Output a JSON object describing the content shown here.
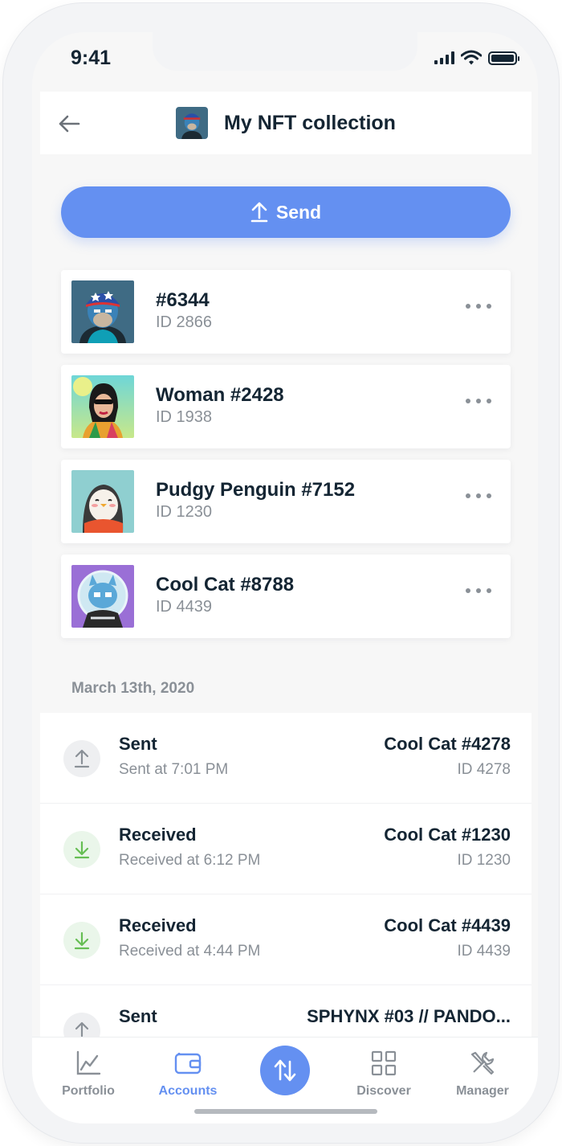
{
  "status_bar": {
    "time": "9:41"
  },
  "header": {
    "title": "My NFT collection",
    "back_icon": "arrow-left-icon"
  },
  "send_button": {
    "label": "Send",
    "icon": "upload-arrow-icon"
  },
  "nfts": [
    {
      "name": "#6344",
      "id": "ID 2866"
    },
    {
      "name": "Woman #2428",
      "id": "ID 1938"
    },
    {
      "name": "Pudgy Penguin #7152",
      "id": "ID 1230"
    },
    {
      "name": "Cool Cat #8788",
      "id": "ID 4439"
    }
  ],
  "history": {
    "date": "March 13th, 2020",
    "transactions": [
      {
        "type": "Sent",
        "time": "Sent at 7:01 PM",
        "nft": "Cool Cat #4278",
        "nft_id": "ID 4278",
        "direction": "sent"
      },
      {
        "type": "Received",
        "time": "Received at 6:12 PM",
        "nft": "Cool Cat #1230",
        "nft_id": "ID 1230",
        "direction": "received"
      },
      {
        "type": "Received",
        "time": "Received at 4:44 PM",
        "nft": "Cool Cat #4439",
        "nft_id": "ID 4439",
        "direction": "received"
      },
      {
        "type": "Sent",
        "time": "",
        "nft": "SPHYNX #03 // PANDO...",
        "nft_id": "",
        "direction": "sent"
      }
    ]
  },
  "tabbar": {
    "items": [
      {
        "label": "Portfolio",
        "icon": "chart-icon",
        "active": false
      },
      {
        "label": "Accounts",
        "icon": "wallet-icon",
        "active": true
      },
      {
        "label": "Discover",
        "icon": "grid-icon",
        "active": false
      },
      {
        "label": "Manager",
        "icon": "tools-icon",
        "active": false
      }
    ],
    "center_icon": "transfer-arrows-icon"
  },
  "colors": {
    "accent": "#6490f1",
    "text_primary": "#142533",
    "text_secondary": "#8a9097",
    "received_green": "#66be54"
  }
}
